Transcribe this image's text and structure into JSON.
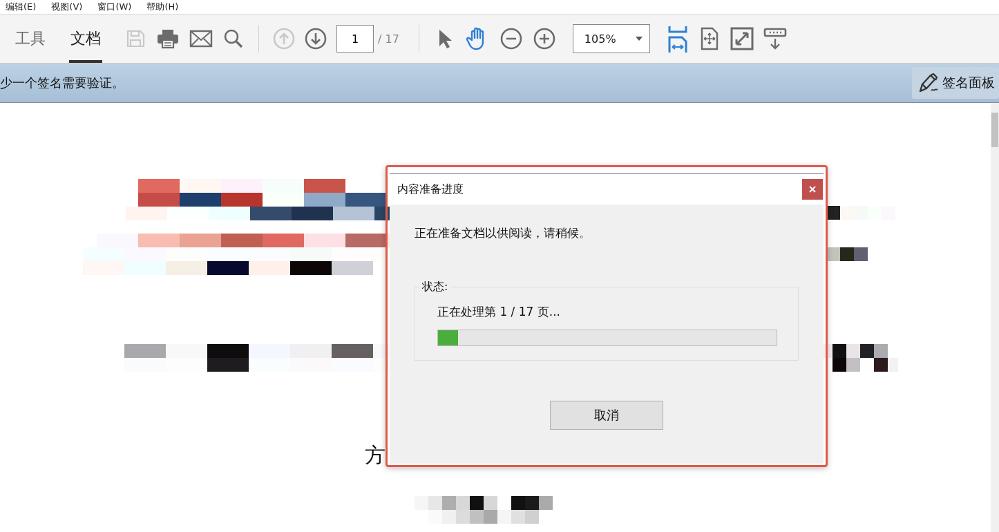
{
  "menu": [
    {
      "label": "编辑(E)"
    },
    {
      "label": "视图(V)"
    },
    {
      "label": "窗口(W)"
    },
    {
      "label": "帮助(H)"
    }
  ],
  "toolbar": {
    "tabs": [
      {
        "label": "工具",
        "selected": false
      },
      {
        "label": "文档",
        "selected": true
      }
    ],
    "actions": [
      {
        "kind": "save",
        "disabled": true
      },
      {
        "kind": "print",
        "disabled": false
      },
      {
        "kind": "email",
        "disabled": false
      },
      {
        "kind": "search",
        "disabled": false
      }
    ],
    "nav": [
      {
        "kind": "previous",
        "disabled": true
      },
      {
        "kind": "next",
        "disabled": false
      }
    ],
    "page_number": "1",
    "page_total": "/ 17",
    "tools": [
      {
        "kind": "select",
        "selected": false
      },
      {
        "kind": "hand",
        "selected": true
      }
    ],
    "zoom_buttons": [
      {
        "kind": "zoom-out"
      },
      {
        "kind": "zoom-in"
      }
    ],
    "zoom_value": "105%",
    "view_buttons": [
      {
        "kind": "fit-width",
        "selected": true
      },
      {
        "kind": "fit-page",
        "selected": false
      },
      {
        "kind": "full-screen",
        "selected": false
      },
      {
        "kind": "read-mode",
        "selected": false
      }
    ]
  },
  "signature_bar": {
    "message": "少一个签名需要验证。",
    "button": "签名面板"
  },
  "document": {
    "texts": [
      "方"
    ]
  },
  "dialog": {
    "title": "内容准备进度",
    "message": "正在准备文档以供阅读，请稍候。",
    "status_label": "状态:",
    "progress_text": "正在处理第 1 / 17 页...",
    "level": 0.06,
    "cancel": "取消"
  }
}
